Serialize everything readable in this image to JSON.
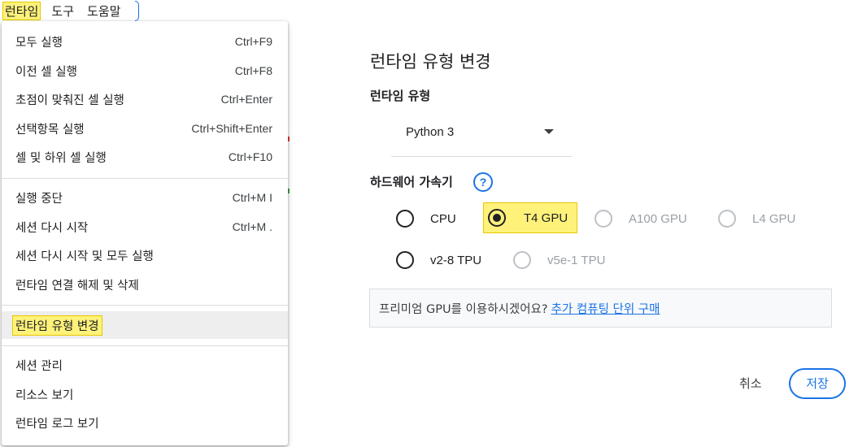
{
  "menubar": {
    "items": [
      "런타임",
      "도구",
      "도움말"
    ]
  },
  "menu": {
    "groups": [
      [
        {
          "label": "모두 실행",
          "shortcut": "Ctrl+F9"
        },
        {
          "label": "이전 셀 실행",
          "shortcut": "Ctrl+F8"
        },
        {
          "label": "초점이 맞춰진 셀 실행",
          "shortcut": "Ctrl+Enter"
        },
        {
          "label": "선택항목 실행",
          "shortcut": "Ctrl+Shift+Enter"
        },
        {
          "label": "셀 및 하위 셀 실행",
          "shortcut": "Ctrl+F10"
        }
      ],
      [
        {
          "label": "실행 중단",
          "shortcut": "Ctrl+M I"
        },
        {
          "label": "세션 다시 시작",
          "shortcut": "Ctrl+M ."
        },
        {
          "label": "세션 다시 시작 및 모두 실행",
          "shortcut": ""
        },
        {
          "label": "런타임 연결 해제 및 삭제",
          "shortcut": ""
        }
      ],
      [
        {
          "label": "런타임 유형 변경",
          "shortcut": ""
        }
      ],
      [
        {
          "label": "세션 관리",
          "shortcut": ""
        },
        {
          "label": "리소스 보기",
          "shortcut": ""
        },
        {
          "label": "런타임 로그 보기",
          "shortcut": ""
        }
      ]
    ]
  },
  "dialog": {
    "title": "런타임 유형 변경",
    "runtime_label": "런타임 유형",
    "runtime_value": "Python 3",
    "hardware_label": "하드웨어 가속기",
    "accelerators": [
      {
        "label": "CPU",
        "selected": false,
        "disabled": false
      },
      {
        "label": "T4 GPU",
        "selected": true,
        "disabled": false
      },
      {
        "label": "A100 GPU",
        "selected": false,
        "disabled": true
      },
      {
        "label": "L4 GPU",
        "selected": false,
        "disabled": true
      },
      {
        "label": "v2-8 TPU",
        "selected": false,
        "disabled": false
      },
      {
        "label": "v5e-1 TPU",
        "selected": false,
        "disabled": true
      }
    ],
    "note_text": "프리미엄 GPU를 이용하시겠어요?",
    "note_link": "추가 컴퓨팅 단위 구매",
    "cancel_label": "취소",
    "save_label": "저장"
  },
  "colors": {
    "highlight": "#fff27a",
    "accent": "#1a73e8"
  }
}
